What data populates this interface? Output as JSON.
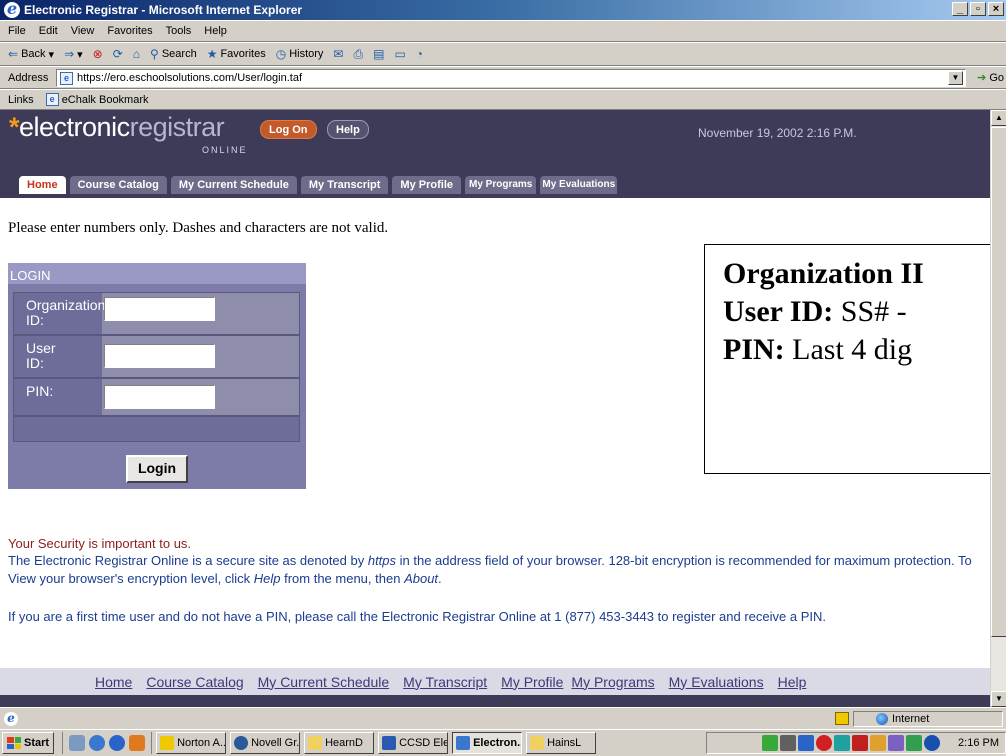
{
  "window": {
    "title": "Electronic Registrar - Microsoft Internet Explorer",
    "controls": [
      "_",
      "̲ᴇ",
      "×"
    ]
  },
  "menu": [
    "File",
    "Edit",
    "View",
    "Favorites",
    "Tools",
    "Help"
  ],
  "toolbar": {
    "back": "Back",
    "search": "Search",
    "favorites": "Favorites",
    "history": "History"
  },
  "address": {
    "label": "Address",
    "url": "https://ero.eschoolsolutions.com/User/login.taf",
    "go": "Go"
  },
  "links": {
    "label": "Links",
    "items": [
      "eChalk Bookmark"
    ]
  },
  "site": {
    "logo_prefix": "electronic",
    "logo_suffix": "registrar",
    "logo_sub": "ONLINE",
    "logon": "Log On",
    "help": "Help",
    "datetime": "November 19, 2002 2:16 P.M.",
    "tabs": [
      "Home",
      "Course Catalog",
      "My Current Schedule",
      "My Transcript",
      "My Profile",
      "My Programs",
      "My Evaluations"
    ],
    "notice": "Please enter numbers only. Dashes and characters are not valid.",
    "login": {
      "heading": "LOGIN",
      "org_label_1": "Organization",
      "org_label_2": "ID:",
      "user_label_1": "User",
      "user_label_2": "ID:",
      "pin_label": "PIN:",
      "button": "Login"
    },
    "overlay": {
      "line1_bold": "Organization II",
      "line2_bold": "User ID:",
      "line2_text": " SS# - ",
      "line3_bold": "PIN:",
      "line3_text": "  Last 4 dig"
    },
    "security": {
      "title": "Your Security is important to us.",
      "p1_a": "The Electronic Registrar Online is a secure site as denoted by ",
      "p1_https": "https",
      "p1_b": " in the address field of your browser. 128-bit encryption is recommended for maximum protection. To View your browser's encryption level, click ",
      "p1_help": "Help",
      "p1_c": " from the menu, then ",
      "p1_about": "About",
      "p1_d": ".",
      "p2": "If you are a first time user and do not have a PIN, please call the Electronic Registrar Online at 1 (877) 453-3443 to register and receive a PIN."
    },
    "footer_links": [
      "Home",
      "Course Catalog",
      "My Current Schedule",
      "My Transcript",
      "My Profile",
      "My Programs",
      "My Evaluations",
      "Help"
    ]
  },
  "status": {
    "zone": "Internet"
  },
  "taskbar": {
    "start": "Start",
    "tasks": [
      "Norton A...",
      "Novell Gr...",
      "HearnD",
      "CCSD Ele...",
      "Electron...",
      "HainsL"
    ],
    "clock": "2:16 PM"
  }
}
